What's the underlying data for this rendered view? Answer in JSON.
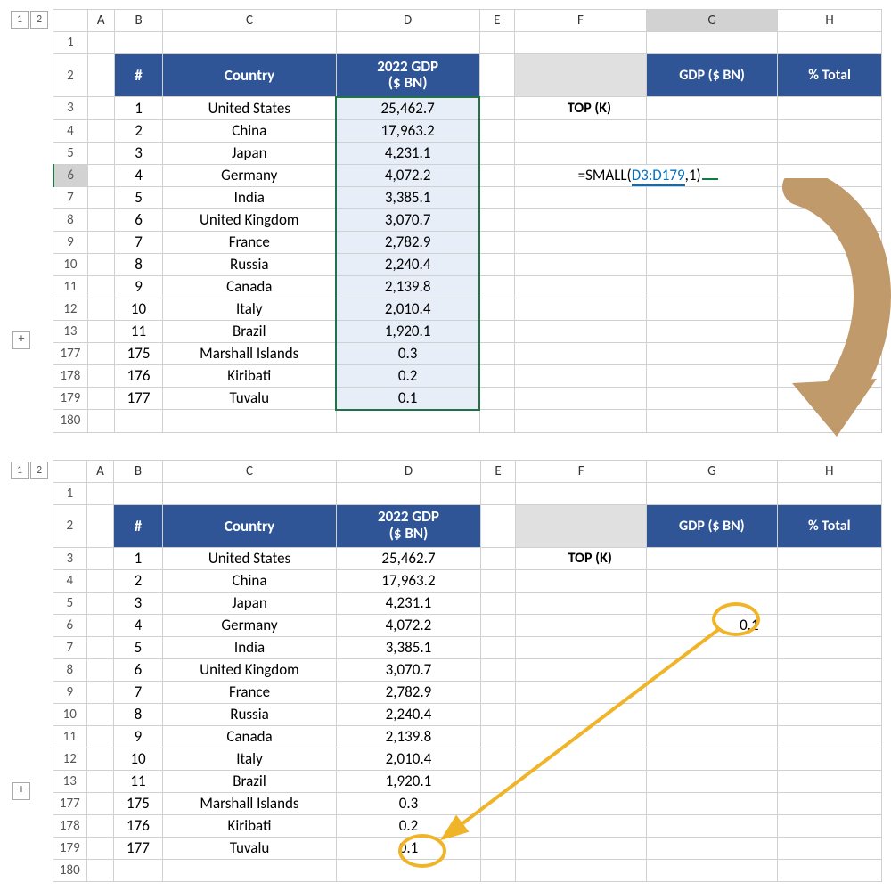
{
  "outline": {
    "b1": "1",
    "b2": "2",
    "plus": "+"
  },
  "cols": {
    "A": "A",
    "B": "B",
    "C": "C",
    "D": "D",
    "E": "E",
    "F": "F",
    "G": "G",
    "H": "H"
  },
  "header": {
    "num": "#",
    "country": "Country",
    "gdp": "2022 GDP\n($ BN)",
    "gdp2": "GDP ($ BN)",
    "pct": "% Total"
  },
  "topk": "TOP (K)",
  "formula": {
    "pre": "=SMALL(",
    "ref": "D3:D179",
    "post": ",1)"
  },
  "result": "0.1",
  "rows": [
    {
      "r": "1"
    },
    {
      "r": "2"
    },
    {
      "r": "3",
      "n": "1",
      "c": "United States",
      "d": "25,462.7"
    },
    {
      "r": "4",
      "n": "2",
      "c": "China",
      "d": "17,963.2"
    },
    {
      "r": "5",
      "n": "3",
      "c": "Japan",
      "d": "4,231.1"
    },
    {
      "r": "6",
      "n": "4",
      "c": "Germany",
      "d": "4,072.2"
    },
    {
      "r": "7",
      "n": "5",
      "c": "India",
      "d": "3,385.1"
    },
    {
      "r": "8",
      "n": "6",
      "c": "United Kingdom",
      "d": "3,070.7"
    },
    {
      "r": "9",
      "n": "7",
      "c": "France",
      "d": "2,782.9"
    },
    {
      "r": "10",
      "n": "8",
      "c": "Russia",
      "d": "2,240.4"
    },
    {
      "r": "11",
      "n": "9",
      "c": "Canada",
      "d": "2,139.8"
    },
    {
      "r": "12",
      "n": "10",
      "c": "Italy",
      "d": "2,010.4"
    },
    {
      "r": "13",
      "n": "11",
      "c": "Brazil",
      "d": "1,920.1"
    },
    {
      "r": "177",
      "n": "175",
      "c": "Marshall Islands",
      "d": "0.3"
    },
    {
      "r": "178",
      "n": "176",
      "c": "Kiribati",
      "d": "0.2"
    },
    {
      "r": "179",
      "n": "177",
      "c": "Tuvalu",
      "d": "0.1"
    },
    {
      "r": "180"
    }
  ]
}
